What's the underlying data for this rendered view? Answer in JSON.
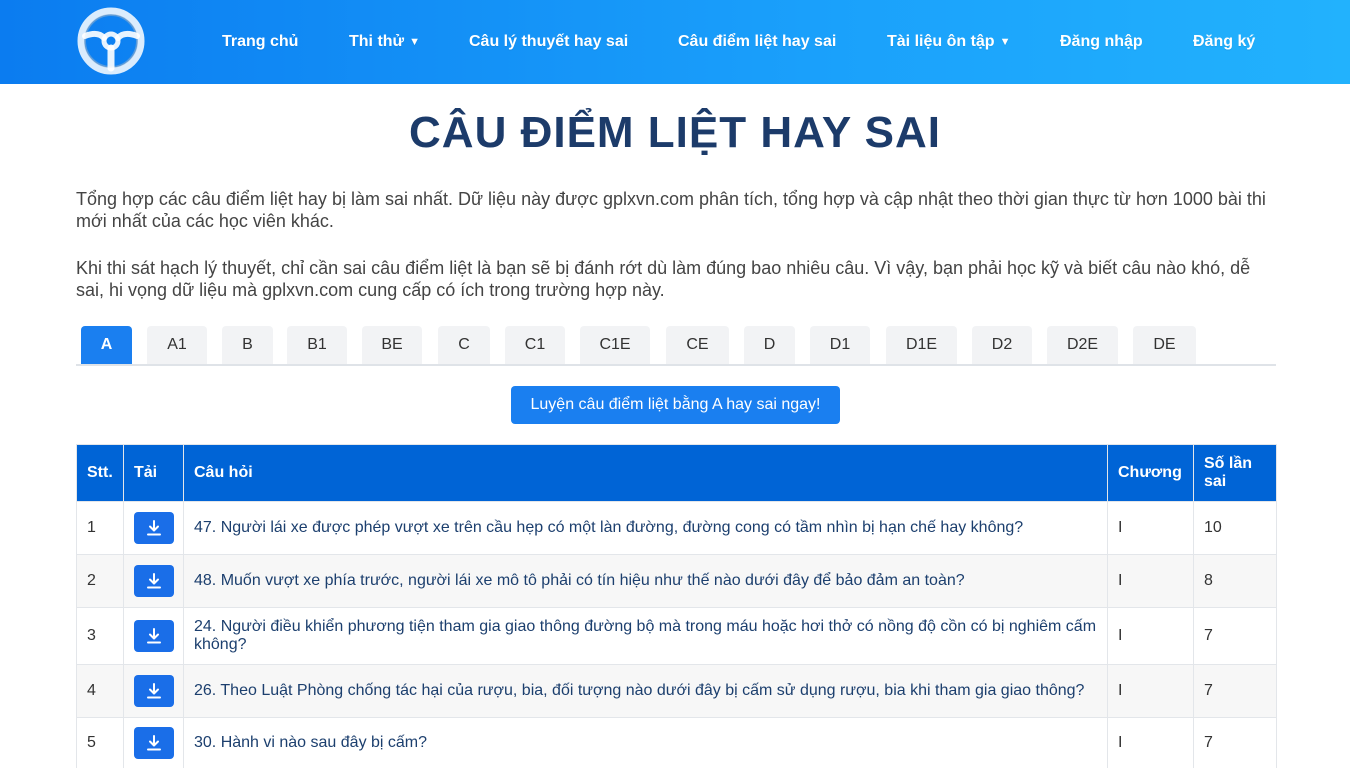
{
  "nav": {
    "items": [
      {
        "label": "Trang chủ",
        "caret": ""
      },
      {
        "label": "Thi thử",
        "caret": "▼"
      },
      {
        "label": "Câu lý thuyết hay sai",
        "caret": ""
      },
      {
        "label": "Câu điểm liệt hay sai",
        "caret": ""
      },
      {
        "label": "Tài liệu ôn tập",
        "caret": "▼"
      },
      {
        "label": "Đăng nhập",
        "caret": ""
      },
      {
        "label": "Đăng ký",
        "caret": ""
      }
    ]
  },
  "page": {
    "title": "CÂU ĐIỂM LIỆT HAY SAI",
    "intro_1": "Tổng hợp các câu điểm liệt hay bị làm sai nhất. Dữ liệu này được gplxvn.com phân tích, tổng hợp và cập nhật theo thời gian thực từ hơn 1000 bài thi mới nhất của các học viên khác.",
    "intro_2": "Khi thi sát hạch lý thuyết, chỉ cần sai câu điểm liệt là bạn sẽ bị đánh rớt dù làm đúng bao nhiêu câu. Vì vậy, bạn phải học kỹ và biết câu nào khó, dễ sai, hi vọng dữ liệu mà gplxvn.com cung cấp có ích trong trường hợp này."
  },
  "tabs": [
    "A",
    "A1",
    "B",
    "B1",
    "BE",
    "C",
    "C1",
    "C1E",
    "CE",
    "D",
    "D1",
    "D1E",
    "D2",
    "D2E",
    "DE"
  ],
  "active_tab": "A",
  "practice_button": "Luyện câu điểm liệt bằng A hay sai ngay!",
  "table": {
    "headers": {
      "stt": "Stt.",
      "download": "Tải",
      "question": "Câu hỏi",
      "chapter": "Chương",
      "wrong_count": "Số lần sai"
    },
    "rows": [
      {
        "stt": "1",
        "question": "47. Người lái xe được phép vượt xe trên cầu hẹp có một làn đường, đường cong có tầm nhìn bị hạn chế hay không?",
        "chapter": "I",
        "wrong": "10"
      },
      {
        "stt": "2",
        "question": "48. Muốn vượt xe phía trước, người lái xe mô tô phải có tín hiệu như thế nào dưới đây để bảo đảm an toàn?",
        "chapter": "I",
        "wrong": "8"
      },
      {
        "stt": "3",
        "question": "24. Người điều khiển phương tiện tham gia giao thông đường bộ mà trong máu hoặc hơi thở có nồng độ cồn có bị nghiêm cấm không?",
        "chapter": "I",
        "wrong": "7"
      },
      {
        "stt": "4",
        "question": "26. Theo Luật Phòng chống tác hại của rượu, bia, đối tượng nào dưới đây bị cấm sử dụng rượu, bia khi tham gia giao thông?",
        "chapter": "I",
        "wrong": "7"
      },
      {
        "stt": "5",
        "question": "30. Hành vi nào sau đây bị cấm?",
        "chapter": "I",
        "wrong": "7"
      }
    ]
  },
  "icons": {
    "logo": "steering-wheel-icon",
    "download": "download-icon"
  },
  "colors": {
    "header_start": "#0b7cf0",
    "header_end": "#22b2fd",
    "accent": "#1a7ff0",
    "table_header": "#0064d6",
    "title": "#1c3b6a"
  }
}
